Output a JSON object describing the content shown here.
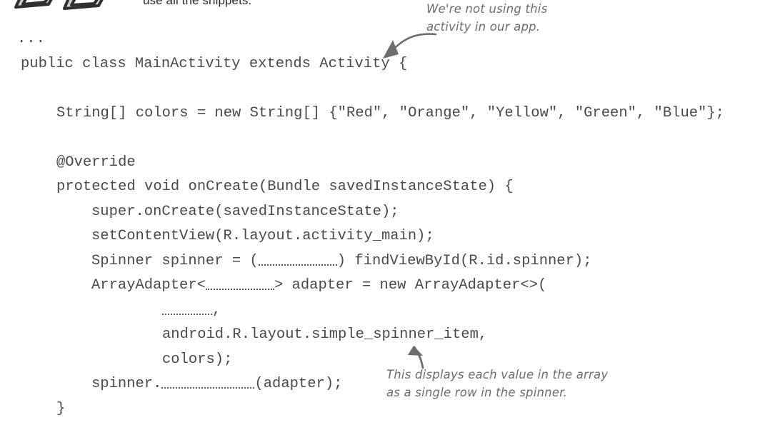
{
  "page": {
    "intro_text": "use all the snippets.",
    "clip_icon": "paperclips-icon"
  },
  "code": {
    "language": "java",
    "lines": [
      {
        "indent": "ellipsis",
        "text": "..."
      },
      {
        "indent": "ind0",
        "text": "public class MainActivity extends Activity {"
      },
      {
        "indent": "blank",
        "text": ""
      },
      {
        "indent": "ind1",
        "text": "String[] colors = new String[] {\"Red\", \"Orange\", \"Yellow\", \"Green\", \"Blue\"};"
      },
      {
        "indent": "blank",
        "text": ""
      },
      {
        "indent": "ind1",
        "text": "@Override"
      },
      {
        "indent": "ind1",
        "text": "protected void onCreate(Bundle savedInstanceState) {"
      },
      {
        "indent": "ind2",
        "text": "super.onCreate(savedInstanceState);"
      },
      {
        "indent": "ind2",
        "text": "setContentView(R.layout.activity_main);"
      },
      {
        "indent": "ind2",
        "segments": [
          {
            "type": "text",
            "text": "Spinner spinner = ("
          },
          {
            "type": "blank",
            "size": "bf-spinner"
          },
          {
            "type": "text",
            "text": ") findViewById(R.id.spinner);"
          }
        ]
      },
      {
        "indent": "ind2",
        "segments": [
          {
            "type": "text",
            "text": "ArrayAdapter<"
          },
          {
            "type": "blank",
            "size": "bf-generic"
          },
          {
            "type": "text",
            "text": "> adapter = new ArrayAdapter<>("
          }
        ]
      },
      {
        "indent": "ind3",
        "segments": [
          {
            "type": "blank",
            "size": "bf-ctx"
          },
          {
            "type": "text",
            "text": ","
          }
        ]
      },
      {
        "indent": "ind3",
        "text": "android.R.layout.simple_spinner_item,"
      },
      {
        "indent": "ind3",
        "text": "colors);"
      },
      {
        "indent": "ind2",
        "segments": [
          {
            "type": "text",
            "text": "spinner."
          },
          {
            "type": "blank",
            "size": "bf-method"
          },
          {
            "type": "text",
            "text": "(adapter);"
          }
        ]
      },
      {
        "indent": "ind1",
        "text": "}"
      }
    ]
  },
  "annotations": {
    "top": {
      "text": "We're not using this\nactivity in our app.",
      "arrow": "curved-arrow-down-left-icon"
    },
    "bottom": {
      "text": "This displays each value in the array\nas a single row in the spinner.",
      "arrow": "arrow-up-icon"
    }
  },
  "colors": {
    "code_text": "#4a4a4a",
    "body_text": "#2b2b2b",
    "annotation": "#6d6d6d",
    "blank_rule": "#5b5b5b",
    "background": "#ffffff"
  }
}
